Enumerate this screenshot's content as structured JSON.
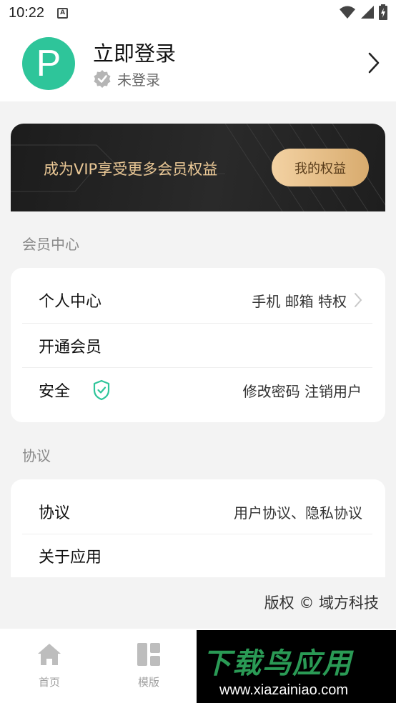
{
  "status_bar": {
    "time": "10:22",
    "notification_icon": "a-icon",
    "icons": [
      "wifi-icon",
      "signal-icon",
      "battery-icon"
    ]
  },
  "header": {
    "avatar_letter": "P",
    "avatar_color": "#2ec59a",
    "title": "立即登录",
    "login_status": "未登录",
    "chevron_icon": "chevron-right-icon"
  },
  "vip_banner": {
    "text": "成为VIP享受更多会员权益",
    "button_label": "我的权益",
    "text_color": "#e9c795"
  },
  "member_section": {
    "title": "会员中心",
    "rows": [
      {
        "label": "个人中心",
        "value": "手机 邮箱 特权"
      },
      {
        "label": "开通会员",
        "value": ""
      },
      {
        "label": "安全",
        "value": "修改密码  注销用户"
      }
    ]
  },
  "agreement_section": {
    "title": "协议",
    "rows": [
      {
        "label": "协议",
        "value": "用户协议、隐私协议"
      },
      {
        "label": "关于应用",
        "value": ""
      }
    ]
  },
  "copyright": "版权 © 域方科技",
  "bottom_nav": {
    "items": [
      {
        "label": "首页",
        "icon": "home-icon"
      },
      {
        "label": "模版",
        "icon": "template-icon"
      }
    ]
  },
  "watermark": {
    "title": "下载鸟应用",
    "url": "www.xiazainiao.com"
  }
}
